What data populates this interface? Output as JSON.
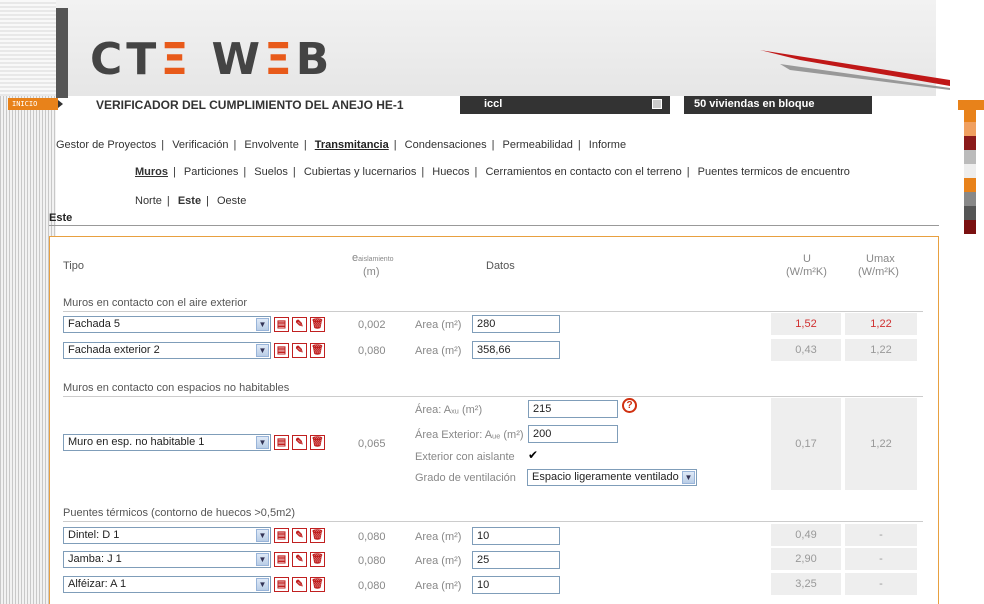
{
  "header": {
    "logo_text": "CTE WEB",
    "inicio": "INICIO",
    "subtitle": "VERIFICADOR DEL CUMPLIMIENTO DEL ANEJO HE-1",
    "tab_project": "iccl",
    "tab_building": "50 viviendas en bloque"
  },
  "nav_main": [
    "Gestor de Proyectos",
    "Verificación",
    "Envolvente",
    "Transmitancia",
    "Condensaciones",
    "Permeabilidad",
    "Informe"
  ],
  "nav_main_active": "Transmitancia",
  "nav_sub": [
    "Muros",
    "Particiones",
    "Suelos",
    "Cubiertas y lucernarios",
    "Huecos",
    "Cerramientos en contacto con el terreno",
    "Puentes termicos de encuentro"
  ],
  "nav_sub_active": "Muros",
  "nav_orient": [
    "Norte",
    "Este",
    "Oeste"
  ],
  "nav_orient_active": "Este",
  "section_title": "Este",
  "table_headers": {
    "tipo": "Tipo",
    "e_main": "e",
    "e_sub": "aislamiento",
    "e_unit": "(m)",
    "datos": "Datos",
    "u": "U",
    "u_unit": "(W/m²K)",
    "umax": "Umax",
    "umax_unit": "(W/m²K)"
  },
  "groups": {
    "aire_exterior": "Muros en contacto con el aire exterior",
    "no_habitables": "Muros en contacto con espacios no habitables",
    "puentes": "Puentes térmicos (contorno de huecos >0,5m2)"
  },
  "rows_aire": [
    {
      "tipo": "Fachada 5",
      "e": "0,002",
      "area_label": "Area (m²)",
      "area": "280",
      "u": "1,52",
      "umax": "1,22",
      "warn": true
    },
    {
      "tipo": "Fachada exterior 2",
      "e": "0,080",
      "area_label": "Area (m²)",
      "area": "358,66",
      "u": "0,43",
      "umax": "1,22",
      "warn": false
    }
  ],
  "row_nohab": {
    "tipo": "Muro en esp. no habitable 1",
    "e": "0,065",
    "area_au_label": "Área: Aₓᵤ (m²)",
    "area_au": "215",
    "area_ext_label": "Área Exterior: Aᵤₑ (m²)",
    "area_ext": "200",
    "aislante_label": "Exterior con aislante",
    "aislante_checked": "✔",
    "ventilacion_label": "Grado de ventilación",
    "ventilacion": "Espacio ligeramente ventilado",
    "u": "0,17",
    "umax": "1,22"
  },
  "rows_puentes": [
    {
      "tipo": "Dintel: D 1",
      "e": "0,080",
      "area_label": "Area (m²)",
      "area": "10",
      "u": "0,49",
      "umax": "-"
    },
    {
      "tipo": "Jamba: J 1",
      "e": "0,080",
      "area_label": "Area (m²)",
      "area": "25",
      "u": "2,90",
      "umax": "-"
    },
    {
      "tipo": "Alféizar: A 1",
      "e": "0,080",
      "area_label": "Area (m²)",
      "area": "10",
      "u": "3,25",
      "umax": "-"
    }
  ],
  "colors": {
    "accent": "#e8821a",
    "brand_dark": "#333333",
    "warn": "#d03030"
  }
}
